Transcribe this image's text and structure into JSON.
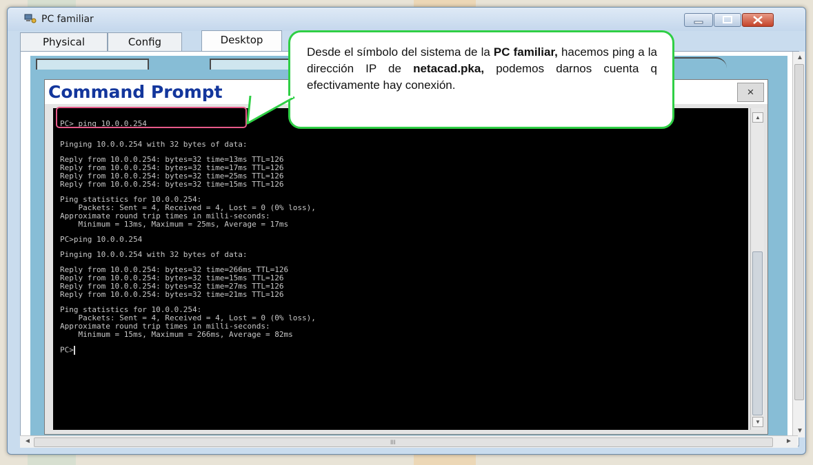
{
  "window": {
    "title": "PC familiar",
    "tabs": [
      {
        "label": "Physical"
      },
      {
        "label": "Config"
      },
      {
        "label": "Desktop"
      }
    ],
    "active_tab": "Desktop",
    "close_symbol": "×"
  },
  "cmd": {
    "title": "Command Prompt",
    "close_symbol": "×",
    "prompt_end": "PC>"
  },
  "terminal_lines": [
    "PC> ping 10.0.0.254",
    "",
    "Pinging 10.0.0.254 with 32 bytes of data:",
    "",
    "Reply from 10.0.0.254: bytes=32 time=13ms TTL=126",
    "Reply from 10.0.0.254: bytes=32 time=17ms TTL=126",
    "Reply from 10.0.0.254: bytes=32 time=25ms TTL=126",
    "Reply from 10.0.0.254: bytes=32 time=15ms TTL=126",
    "",
    "Ping statistics for 10.0.0.254:",
    "    Packets: Sent = 4, Received = 4, Lost = 0 (0% loss),",
    "Approximate round trip times in milli-seconds:",
    "    Minimum = 13ms, Maximum = 25ms, Average = 17ms",
    "",
    "PC>ping 10.0.0.254",
    "",
    "Pinging 10.0.0.254 with 32 bytes of data:",
    "",
    "Reply from 10.0.0.254: bytes=32 time=266ms TTL=126",
    "Reply from 10.0.0.254: bytes=32 time=15ms TTL=126",
    "Reply from 10.0.0.254: bytes=32 time=27ms TTL=126",
    "Reply from 10.0.0.254: bytes=32 time=21ms TTL=126",
    "",
    "Ping statistics for 10.0.0.254:",
    "    Packets: Sent = 4, Received = 4, Lost = 0 (0% loss),",
    "Approximate round trip times in milli-seconds:",
    "    Minimum = 15ms, Maximum = 266ms, Average = 82ms"
  ],
  "callout": {
    "p1": "Desde el símbolo del sistema de la ",
    "b1": "PC familiar,",
    "p2": " hacemos ping a la dirección IP de ",
    "b2": "netacad.pka,",
    "p3": " podemos darnos cuenta q efectivamente hay conexión."
  },
  "scrollbar": {
    "h_center_mark": "III"
  },
  "colors": {
    "cmd_title": "#13369c",
    "callout_border": "#2fcf45",
    "highlight_border": "#e85a8a",
    "terminal_bg": "#000000",
    "terminal_text": "#c8c8c8"
  },
  "icons": [
    "network-pc-icon",
    "minimize-icon",
    "maximize-icon",
    "close-icon"
  ]
}
